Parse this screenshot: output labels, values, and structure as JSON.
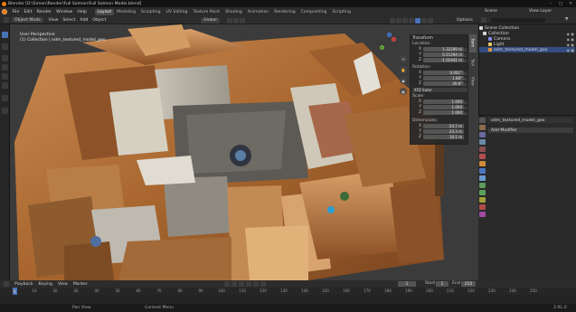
{
  "window": {
    "title": "Blender [D:\\Simon\\Render\\Full Salmon\\Full Salmon Model.blend]"
  },
  "menu": {
    "items": [
      "File",
      "Edit",
      "Render",
      "Window",
      "Help"
    ]
  },
  "workspaces": [
    "Layout",
    "Modeling",
    "Sculpting",
    "UV Editing",
    "Texture Paint",
    "Shading",
    "Animation",
    "Rendering",
    "Compositing",
    "Scripting"
  ],
  "active_workspace": "Layout",
  "scene": {
    "name": "Scene",
    "view_layer": "View Layer"
  },
  "viewport_header": {
    "mode": "Object Mode",
    "items": [
      "View",
      "Select",
      "Add",
      "Object"
    ],
    "orientation": "Global",
    "options": "Options"
  },
  "viewport_info": {
    "line1": "User Perspective",
    "line2": "(1) Collection | odm_textured_model_geo"
  },
  "npanel": {
    "header": "Transform",
    "location_label": "Location:",
    "location": [
      {
        "axis": "X",
        "value": "1.32299 m"
      },
      {
        "axis": "Y",
        "value": "0.21294 m"
      },
      {
        "axis": "Z",
        "value": "-1.02441 m"
      }
    ],
    "rotation_label": "Rotation:",
    "rotation": [
      {
        "axis": "X",
        "value": "0.001°"
      },
      {
        "axis": "Y",
        "value": "1.68°"
      },
      {
        "axis": "Z",
        "value": "39.8°"
      }
    ],
    "rotation_mode": "XYZ Euler",
    "scale_label": "Scale:",
    "scale": [
      {
        "axis": "X",
        "value": "1.000"
      },
      {
        "axis": "Y",
        "value": "1.000"
      },
      {
        "axis": "Z",
        "value": "1.000"
      }
    ],
    "dimensions_label": "Dimensions:",
    "dimensions": [
      {
        "axis": "X",
        "value": "24.7 m"
      },
      {
        "axis": "Y",
        "value": "23.3 m"
      },
      {
        "axis": "Z",
        "value": "10.1 m"
      }
    ],
    "tabs": [
      "Item",
      "Tool",
      "View"
    ]
  },
  "outliner": {
    "title": "Scene Collection",
    "rows": [
      {
        "label": "Collection",
        "color": "#d7d7d7"
      },
      {
        "label": "Camera",
        "color": "#8a8af0"
      },
      {
        "label": "Light",
        "color": "#e6c76b"
      },
      {
        "label": "odm_textured_model_geo",
        "color": "#e88f3a"
      }
    ]
  },
  "properties": {
    "object_name": "odm_textured_model_geo",
    "add_modifier": "Add Modifier"
  },
  "timeline": {
    "items": [
      "Playback",
      "Keying",
      "View",
      "Marker"
    ],
    "current_frame": "1",
    "start_label": "Start",
    "start": "1",
    "end_label": "End",
    "end": "250",
    "ticks": [
      "0",
      "10",
      "20",
      "30",
      "40",
      "50",
      "60",
      "70",
      "80",
      "90",
      "100",
      "110",
      "120",
      "130",
      "140",
      "150",
      "160",
      "170",
      "180",
      "190",
      "200",
      "210",
      "220",
      "230",
      "240",
      "250"
    ]
  },
  "statusbar": {
    "left": "Pan View",
    "mid": "Context Menu",
    "version": "2.91.0"
  }
}
